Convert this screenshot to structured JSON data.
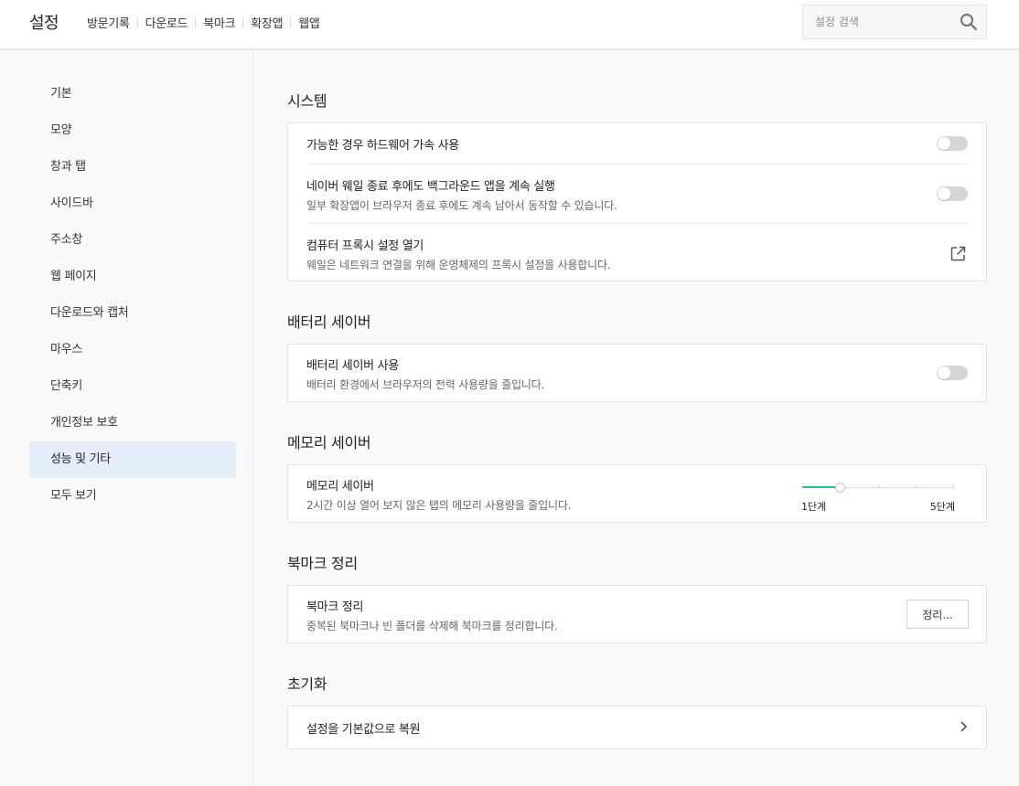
{
  "header": {
    "title": "설정",
    "nav": [
      "방문기록",
      "다운로드",
      "북마크",
      "확장앱",
      "웹앱"
    ],
    "search_placeholder": "설정 검색"
  },
  "sidebar": {
    "items": [
      {
        "label": "기본"
      },
      {
        "label": "모양"
      },
      {
        "label": "창과 탭"
      },
      {
        "label": "사이드바"
      },
      {
        "label": "주소창"
      },
      {
        "label": "웹 페이지"
      },
      {
        "label": "다운로드와 캡처"
      },
      {
        "label": "마우스"
      },
      {
        "label": "단축키"
      },
      {
        "label": "개인정보 보호"
      },
      {
        "label": "성능 및 기타",
        "active": true
      },
      {
        "label": "모두 보기"
      }
    ]
  },
  "system": {
    "title": "시스템",
    "hw_accel": {
      "label": "가능한 경우 하드웨어 가속 사용",
      "enabled": false
    },
    "background": {
      "label": "네이버 웨일 종료 후에도 백그라운드 앱을 계속 실행",
      "desc": "일부 확장앱이 브라우저 종료 후에도 계속 남아서 동작할 수 있습니다.",
      "enabled": false
    },
    "proxy": {
      "label": "컴퓨터 프록시 설정 열기",
      "desc": "웨일은 네트워크 연결을 위해 운영체제의 프록시 설정을 사용합니다.",
      "icon": "external-link-icon"
    }
  },
  "battery": {
    "title": "배터리 세이버",
    "label": "배터리 세이버 사용",
    "desc": "배터리 환경에서 브라우저의 전력 사용량을 줄입니다.",
    "enabled": false
  },
  "memory": {
    "title": "메모리 세이버",
    "label": "메모리 세이버",
    "desc": "2시간 이상 열어 보지 않은 탭의 메모리 사용량을 줄입니다.",
    "slider": {
      "min_label": "1단계",
      "max_label": "5단계",
      "steps": 5,
      "value": 2
    },
    "accent_color": "#1fc39b"
  },
  "bookmark": {
    "title": "북마크 정리",
    "label": "북마크 정리",
    "desc": "중복된 북마크나 빈 폴더를 삭제해 북마크를 정리합니다.",
    "button": "정리..."
  },
  "reset": {
    "title": "초기화",
    "label": "설정을 기본값으로 복원",
    "icon": "chevron-right-icon"
  }
}
